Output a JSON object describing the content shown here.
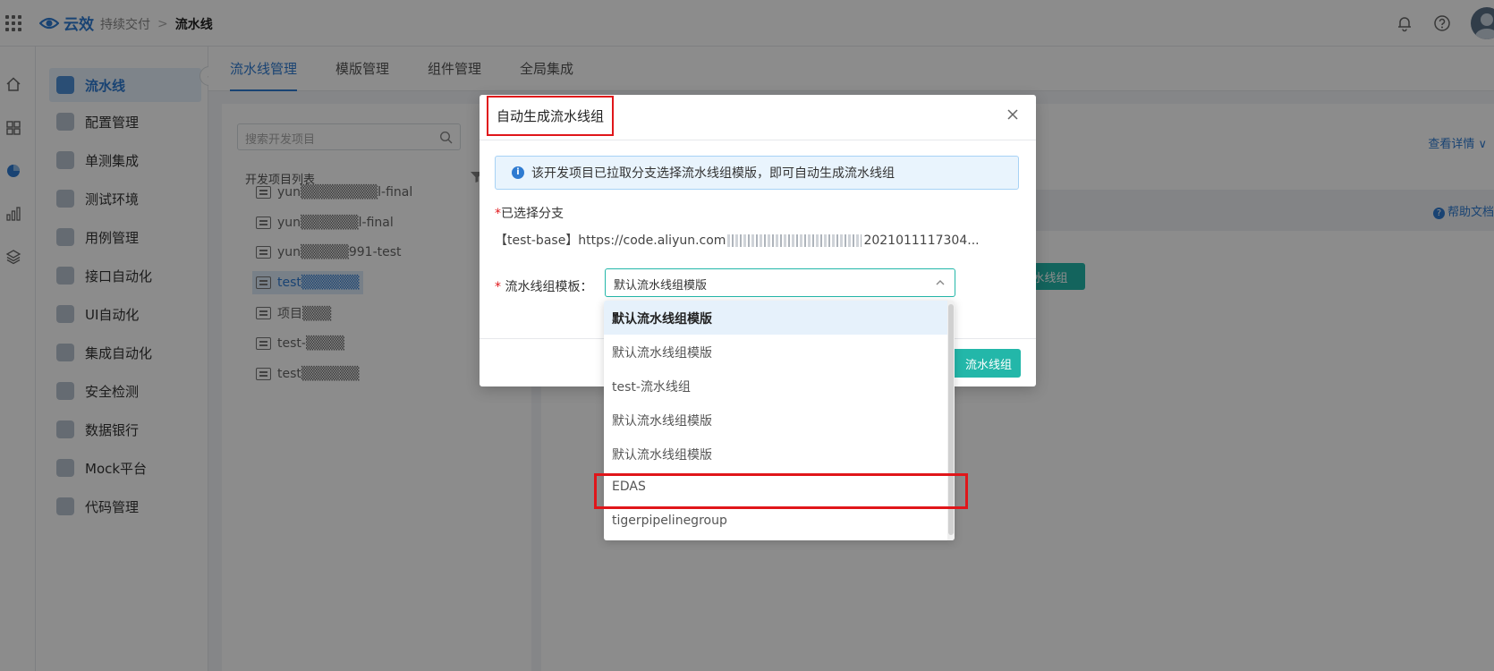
{
  "header": {
    "logo_text": "云效",
    "breadcrumb": [
      "持续交付",
      "流水线"
    ],
    "separator": ">",
    "icons": [
      "bell-icon",
      "help-icon",
      "avatar"
    ]
  },
  "rail": {
    "icons": [
      "home-icon",
      "apps-icon",
      "chart-pie-icon",
      "bar-chart-icon",
      "layers-icon"
    ]
  },
  "sidenav": {
    "items": [
      {
        "label": "流水线",
        "active": true
      },
      {
        "label": "配置管理"
      },
      {
        "label": "单测集成"
      },
      {
        "label": "测试环境"
      },
      {
        "label": "用例管理"
      },
      {
        "label": "接口自动化"
      },
      {
        "label": "UI自动化"
      },
      {
        "label": "集成自动化"
      },
      {
        "label": "安全检测"
      },
      {
        "label": "数据银行"
      },
      {
        "label": "Mock平台"
      },
      {
        "label": "代码管理"
      }
    ]
  },
  "tabs": [
    {
      "label": "流水线管理",
      "active": true
    },
    {
      "label": "模版管理"
    },
    {
      "label": "组件管理"
    },
    {
      "label": "全局集成"
    }
  ],
  "projects": {
    "search_placeholder": "搜索开发项目",
    "list_label": "开发项目列表",
    "items": [
      {
        "label": "yun▒▒▒▒▒▒▒▒l-final"
      },
      {
        "label": "yun▒▒▒▒▒▒l-final"
      },
      {
        "label": "yun▒▒▒▒▒991-test"
      },
      {
        "label": "test▒▒▒▒▒▒",
        "selected": true
      },
      {
        "label": "项目▒▒▒"
      },
      {
        "label": "test-▒▒▒▒"
      },
      {
        "label": "test▒▒▒▒▒▒"
      }
    ]
  },
  "content": {
    "detail_link": "查看详情 ∨",
    "help_link": "帮助文档",
    "button_label": "水线组"
  },
  "dialog": {
    "title": "自动生成流水线组",
    "info": "该开发项目已拉取分支选择流水线组模版，即可自动生成流水线组",
    "branch_label": "已选择分支",
    "branch_prefix": "【test-base】https://code.aliyun.com",
    "branch_suffix": "2021011117304...",
    "template_label": "流水线组模板：",
    "template_value": "默认流水线组模版",
    "confirm_label": "流水线组"
  },
  "dropdown": {
    "options": [
      "默认流水线组模版",
      "默认流水线组模版",
      "test-流水线组",
      "默认流水线组模版",
      "默认流水线组模版",
      "EDAS",
      "tigerpipelinegroup"
    ],
    "highlighted_index": 0,
    "boxed_index": 5
  },
  "colors": {
    "accent": "#2f7bd1",
    "teal": "#23b7a9",
    "annotation_red": "#e0161a"
  }
}
